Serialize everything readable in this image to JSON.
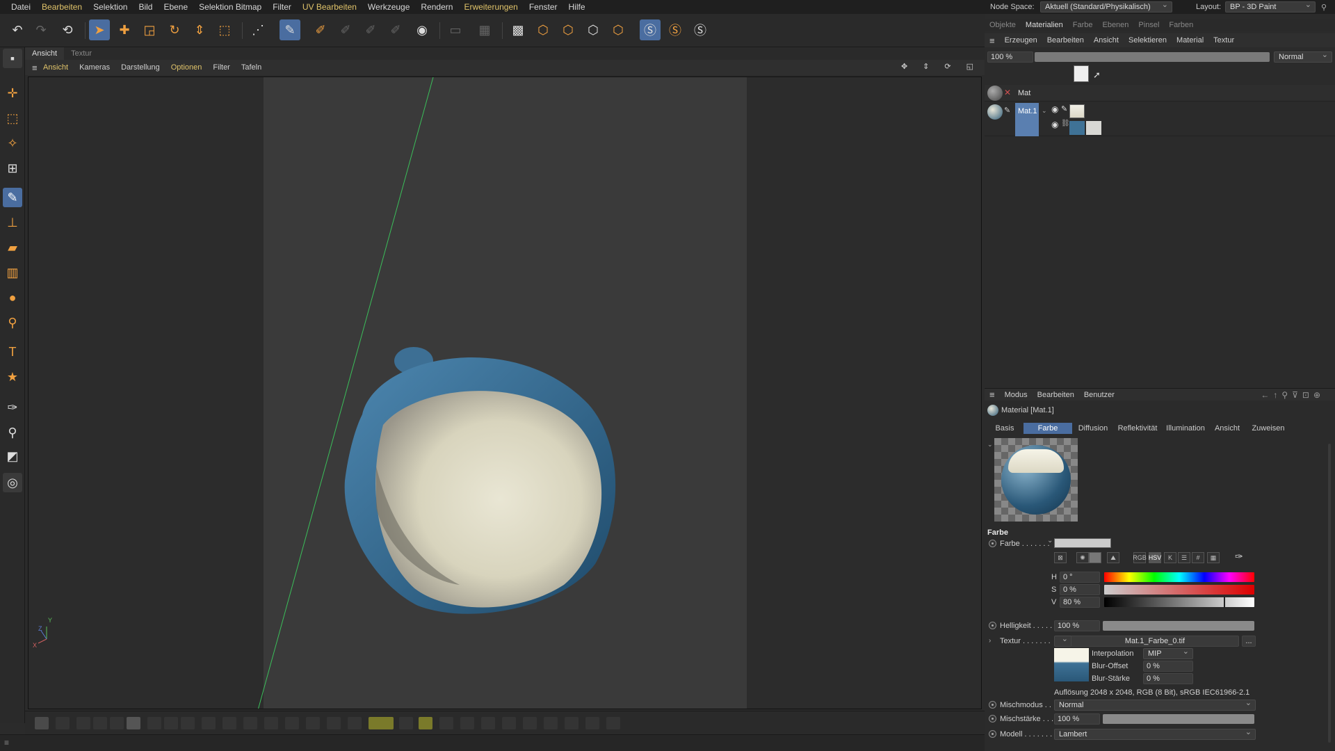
{
  "menubar": {
    "items": [
      "Datei",
      "Bearbeiten",
      "Selektion",
      "Bild",
      "Ebene",
      "Selektion Bitmap",
      "Filter",
      "UV Bearbeiten",
      "Werkzeuge",
      "Rendern",
      "Erweiterungen",
      "Fenster",
      "Hilfe"
    ],
    "highlighted": [
      "Bearbeiten",
      "UV Bearbeiten",
      "Erweiterungen"
    ]
  },
  "node_space": {
    "label": "Node Space:",
    "value": "Aktuell (Standard/Physikalisch)"
  },
  "layout": {
    "label": "Layout:",
    "value": "BP - 3D Paint"
  },
  "viewport": {
    "tabs": [
      "Ansicht",
      "Textur"
    ],
    "menu": [
      "Ansicht",
      "Kameras",
      "Darstellung",
      "Optionen",
      "Filter",
      "Tafeln"
    ],
    "axis_labels": {
      "y": "Y",
      "z": "Z",
      "x": "X"
    }
  },
  "right_panel": {
    "tabs": [
      "Objekte",
      "Materialien",
      "Farbe",
      "Ebenen",
      "Pinsel",
      "Farben"
    ],
    "active_tab": "Materialien",
    "menu": [
      "Erzeugen",
      "Bearbeiten",
      "Ansicht",
      "Selektieren",
      "Material",
      "Textur"
    ],
    "opacity": "100 %",
    "blend_mode": "Normal",
    "materials": [
      "Mat",
      "Mat.1"
    ]
  },
  "attributes": {
    "menu": [
      "Modus",
      "Bearbeiten",
      "Benutzer"
    ],
    "title": "Material [Mat.1]",
    "tabs": [
      "Basis",
      "Farbe",
      "Diffusion",
      "Reflektivität",
      "Illumination",
      "Ansicht",
      "Zuweisen"
    ],
    "active_tab": "Farbe",
    "section": "Farbe",
    "farbe_label": "Farbe . . . . . . .",
    "color_mode_buttons": [
      "RGB",
      "HSV",
      "K",
      "#"
    ],
    "h": {
      "label": "H",
      "value": "0 °"
    },
    "s": {
      "label": "S",
      "value": "0 %"
    },
    "v": {
      "label": "V",
      "value": "80 %",
      "level": 0.8
    },
    "helligkeit": {
      "label": "Helligkeit . . . . .",
      "value": "100 %"
    },
    "textur": {
      "label": "Textur . . . . . . .",
      "file": "Mat.1_Farbe_0.tif",
      "more": "..."
    },
    "interpolation": {
      "label": "Interpolation",
      "value": "MIP"
    },
    "blur_offset": {
      "label": "Blur-Offset",
      "value": "0 %"
    },
    "blur_staerke": {
      "label": "Blur-Stärke",
      "value": "0 %"
    },
    "resolution": "Auflösung 2048 x 2048, RGB (8 Bit), sRGB IEC61966-2.1",
    "mischmodus": {
      "label": "Mischmodus . . .",
      "value": "Normal"
    },
    "mischstaerke": {
      "label": "Mischstärke . . .",
      "value": "100 %"
    },
    "modell": {
      "label": "Modell . . . . . . .",
      "value": "Lambert"
    }
  },
  "colors": {
    "accent": "#4a6da0",
    "highlight_text": "#e0c36a",
    "tool_orange": "#f0a040"
  }
}
